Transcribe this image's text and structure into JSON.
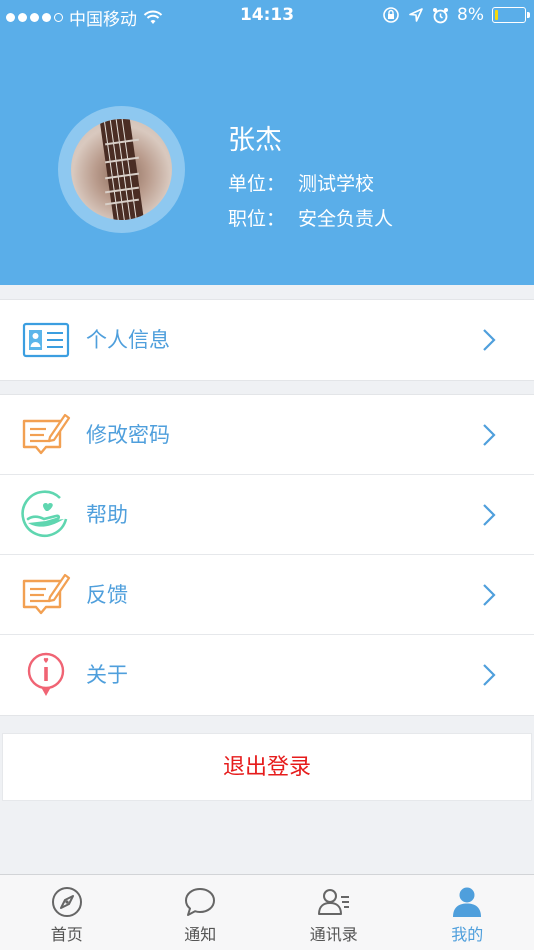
{
  "status_bar": {
    "carrier": "中国移动",
    "time": "14:13",
    "battery_percent": "8%",
    "signal_icon": "signal-dots-icon",
    "wifi_icon": "wifi-icon",
    "lock_icon": "rotation-lock-icon",
    "location_icon": "location-arrow-icon",
    "alarm_icon": "alarm-clock-icon",
    "battery_icon": "battery-icon"
  },
  "profile": {
    "name": "张杰",
    "unit_label": "单位：",
    "unit_value": "测试学校",
    "position_label": "职位：",
    "position_value": "安全负责人",
    "avatar_icon": "guitar-neck-avatar"
  },
  "menu_group_1": [
    {
      "label": "个人信息",
      "icon": "id-card-icon"
    }
  ],
  "menu_group_2": [
    {
      "label": "修改密码",
      "icon": "edit-note-icon"
    },
    {
      "label": "帮助",
      "icon": "helping-hand-icon"
    },
    {
      "label": "反馈",
      "icon": "feedback-note-icon"
    },
    {
      "label": "关于",
      "icon": "info-pin-icon"
    }
  ],
  "logout_label": "退出登录",
  "tabbar": {
    "tabs": [
      {
        "label": "首页",
        "icon": "compass-icon"
      },
      {
        "label": "通知",
        "icon": "chat-bubble-icon"
      },
      {
        "label": "通讯录",
        "icon": "contacts-icon"
      },
      {
        "label": "我的",
        "icon": "person-icon"
      }
    ],
    "active_index": 3
  },
  "colors": {
    "header_bg": "#5aaee9",
    "accent_blue": "#4f9fdc",
    "logout_red": "#e61c1c",
    "icon_orange": "#f2a052",
    "icon_green": "#5fd6b0",
    "icon_pink": "#f06474",
    "page_bg": "#eff1f4"
  }
}
